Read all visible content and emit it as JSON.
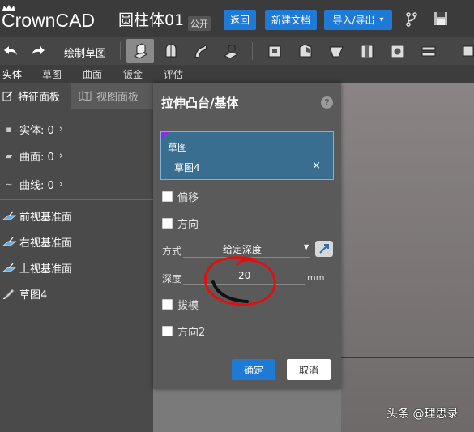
{
  "app": {
    "logo_text": "CrownCAD",
    "document_title": "圆柱体01",
    "public_badge": "公开"
  },
  "header": {
    "back_label": "返回",
    "new_doc_label": "新建文档",
    "import_export_label": "导入/导出",
    "import_export_caret": "⌄"
  },
  "toolbar": {
    "sketch_label": "绘制草图"
  },
  "tabs": [
    {
      "label": "实体",
      "active": true
    },
    {
      "label": "草图",
      "active": false
    },
    {
      "label": "曲面",
      "active": false
    },
    {
      "label": "钣金",
      "active": false
    },
    {
      "label": "评估",
      "active": false
    }
  ],
  "left_panel": {
    "feature_tab": "特征面板",
    "view_tab": "视图面板",
    "items": [
      {
        "label": "实体: 0",
        "icon": "solid-icon",
        "has_caret": true
      },
      {
        "label": "曲面: 0",
        "icon": "surface-icon",
        "has_caret": true
      },
      {
        "label": "曲线: 0",
        "icon": "curve-icon",
        "has_caret": true
      },
      {
        "label": "前视基准面",
        "icon": "plane-icon"
      },
      {
        "label": "右视基准面",
        "icon": "plane-icon"
      },
      {
        "label": "上视基准面",
        "icon": "plane-icon"
      },
      {
        "label": "草图4",
        "icon": "sketch-icon"
      }
    ]
  },
  "dialog": {
    "title": "拉伸凸台/基体",
    "help": "?",
    "selection_label": "草图",
    "selection_item": "草图4",
    "selection_remove": "×",
    "offset_label": "偏移",
    "direction_label": "方向",
    "method_label": "方式",
    "method_value": "给定深度",
    "depth_label": "深度",
    "depth_value": "20",
    "depth_unit": "mm",
    "draft_label": "拔模",
    "direction2_label": "方向2",
    "ok_label": "确定",
    "cancel_label": "取消"
  },
  "watermark": "头条 @理思录",
  "colors": {
    "primary_button": "#1f7ad6",
    "selection_bg": "#3a6e91",
    "annotation_red": "#e01010"
  }
}
